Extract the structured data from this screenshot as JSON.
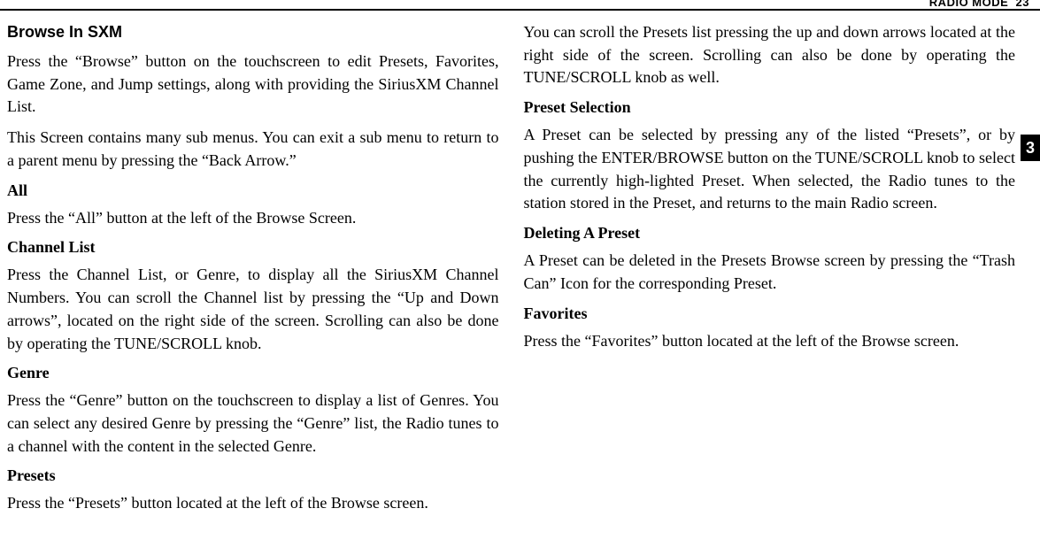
{
  "header": {
    "label": "RADIO MODE",
    "page": "23"
  },
  "sectionTab": "3",
  "left": {
    "title": "Browse In SXM",
    "p1": "Press the “Browse” button on the touchscreen to edit Presets, Favorites, Game Zone, and Jump settings, along with providing the SiriusXM Channel List.",
    "p2": "This Screen contains many sub menus. You can exit a sub menu to return to a parent menu by pressing the “Back Arrow.”",
    "h_all": "All",
    "p3": "Press the “All” button at the left of the Browse Screen.",
    "h_channel": "Channel List",
    "p4": "Press the Channel List, or Genre, to display all the SiriusXM Channel Numbers. You can scroll the Channel list by pressing the “Up and Down arrows”, located on the right side of the screen. Scrolling can also be done by operating the TUNE/SCROLL knob.",
    "h_genre": "Genre",
    "p5": "Press the “Genre” button on the touchscreen to display a list of Genres. You can select any desired Genre by pressing the “Genre” list, the Radio tunes to a channel with the content in the selected Genre."
  },
  "right": {
    "h_presets": "Presets",
    "p6": "Press the “Presets” button located at the left of the Browse screen.",
    "p7": "You can scroll the Presets list pressing the up and down arrows located at the right side of the screen. Scrolling can also be done by operating the TUNE/SCROLL knob as well.",
    "h_preset_sel": "Preset Selection",
    "p8": "A Preset can be selected by pressing any of the listed “Presets”, or by pushing the ENTER/BROWSE button on the TUNE/SCROLL knob to select the currently high-lighted Preset. When selected, the Radio tunes to the station stored in the Preset, and returns to the main Radio screen.",
    "h_deleting": "Deleting A Preset",
    "p9": "A Preset can be deleted in the Presets Browse screen by pressing the “Trash Can” Icon for the corresponding Preset.",
    "h_favorites": "Favorites",
    "p10": "Press the “Favorites” button located at the left of the Browse screen."
  }
}
